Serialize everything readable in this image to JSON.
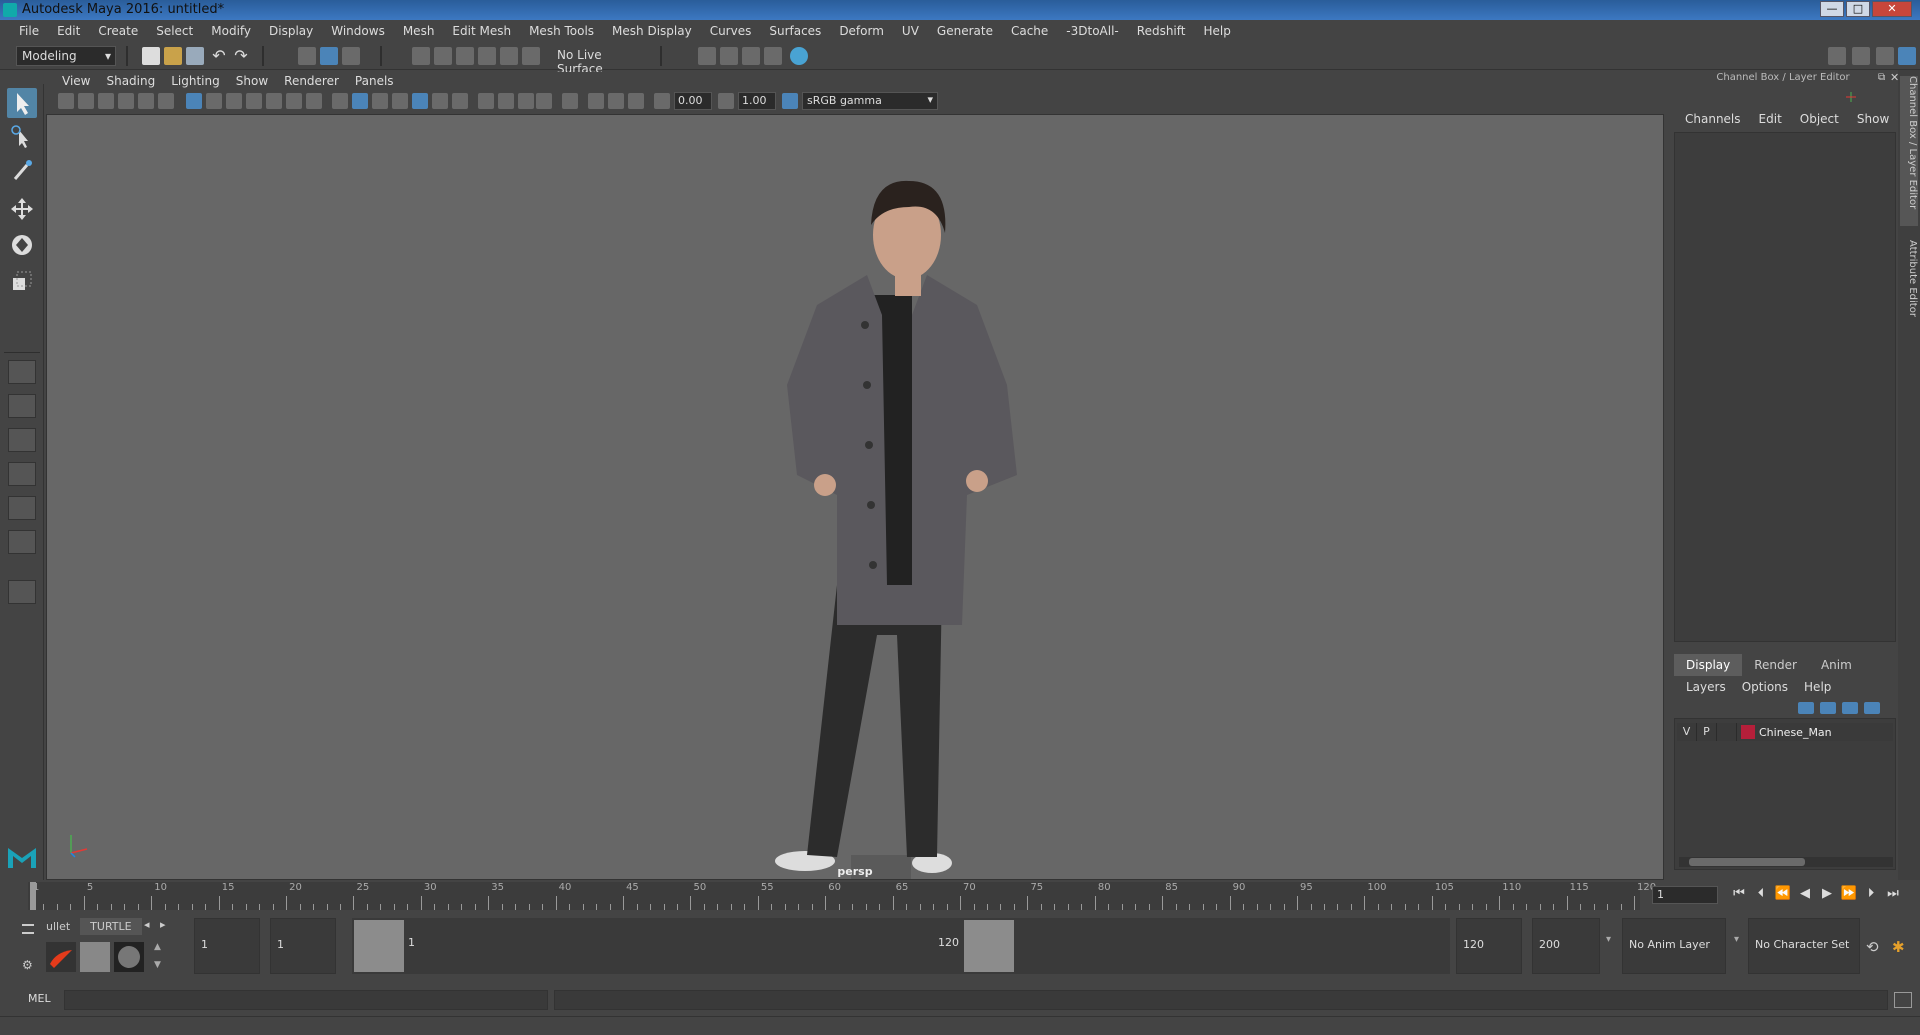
{
  "window": {
    "title": "Autodesk Maya 2016: untitled*",
    "min_label": "—",
    "max_label": "□",
    "close_label": "✕"
  },
  "menubar": [
    "File",
    "Edit",
    "Create",
    "Select",
    "Modify",
    "Display",
    "Windows",
    "Mesh",
    "Edit Mesh",
    "Mesh Tools",
    "Mesh Display",
    "Curves",
    "Surfaces",
    "Deform",
    "UV",
    "Generate",
    "Cache",
    "-3DtoAll-",
    "Redshift",
    "Help"
  ],
  "statusline": {
    "menuset": "Modeling",
    "live_surface": "No Live Surface"
  },
  "panel": {
    "menu": [
      "View",
      "Shading",
      "Lighting",
      "Show",
      "Renderer",
      "Panels"
    ],
    "exposure": "0.00",
    "gamma": "1.00",
    "colorspace": "sRGB gamma",
    "camera": "persp"
  },
  "right_panel": {
    "title": "Channel Box / Layer Editor",
    "cb_menu": [
      "Channels",
      "Edit",
      "Object",
      "Show"
    ],
    "vertical_tabs": [
      "Channel Box / Layer Editor",
      "Attribute Editor"
    ],
    "le_tabs": [
      "Display",
      "Render",
      "Anim"
    ],
    "le_menu": [
      "Layers",
      "Options",
      "Help"
    ],
    "layer": {
      "v": "V",
      "p": "P",
      "name": "Chinese_Man",
      "color": "#b51f3a"
    }
  },
  "timeline": {
    "ticks": [
      1,
      5,
      10,
      15,
      20,
      25,
      30,
      35,
      40,
      45,
      50,
      55,
      60,
      65,
      70,
      75,
      80,
      85,
      90,
      95,
      100,
      105,
      110,
      115,
      120
    ],
    "current_frame": "1",
    "playback": [
      "⏮",
      "⏭",
      "⏴",
      "◀",
      "▶",
      "⏵",
      "⏭",
      "⏭"
    ]
  },
  "range": {
    "shelf_tabs": [
      "ullet",
      "TURTLE"
    ],
    "start": "1",
    "min": "1",
    "slider_start": "1",
    "slider_end": "120",
    "end": "120",
    "max": "200",
    "anim_layer": "No Anim Layer",
    "char_set": "No Character Set"
  },
  "cmd": {
    "label": "MEL"
  }
}
